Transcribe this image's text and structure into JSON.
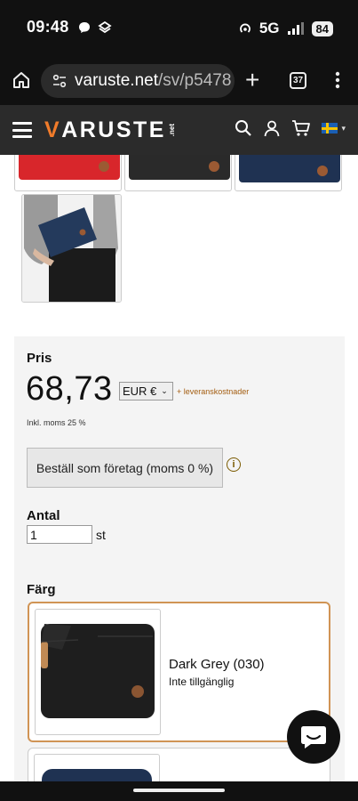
{
  "status_bar": {
    "time": "09:48",
    "network": "5G",
    "battery": "84"
  },
  "browser": {
    "url_host": "varuste.net",
    "url_path": "/sv/p5478",
    "tab_count": "37"
  },
  "site": {
    "logo_v": "V",
    "logo_rest": "ARUSTE",
    "logo_net": ".net"
  },
  "product": {
    "price_label": "Pris",
    "price": "68,73",
    "currency": "EUR €",
    "shipping_link": "+ leveranskostnader",
    "vat_note": "Inkl. moms 25 %",
    "company_order_button": "Beställ som företag (moms 0 %)",
    "quantity_label": "Antal",
    "quantity_value": "1",
    "quantity_unit": "st",
    "color_label": "Färg",
    "color_options": [
      {
        "name": "Dark Grey (030)",
        "availability": "Inte tillgänglig"
      }
    ]
  },
  "colors": {
    "brand_orange": "#f07b2a",
    "header_bg": "#2b2b2b",
    "selected_border": "#d09455",
    "link_color": "#a35d10"
  },
  "icons": [
    "home-icon",
    "site-info-icon",
    "plus-icon",
    "tabs-icon",
    "more-vert-icon",
    "hamburger-icon",
    "search-icon",
    "account-icon",
    "cart-icon",
    "sweden-flag-icon",
    "info-icon",
    "chat-icon"
  ]
}
